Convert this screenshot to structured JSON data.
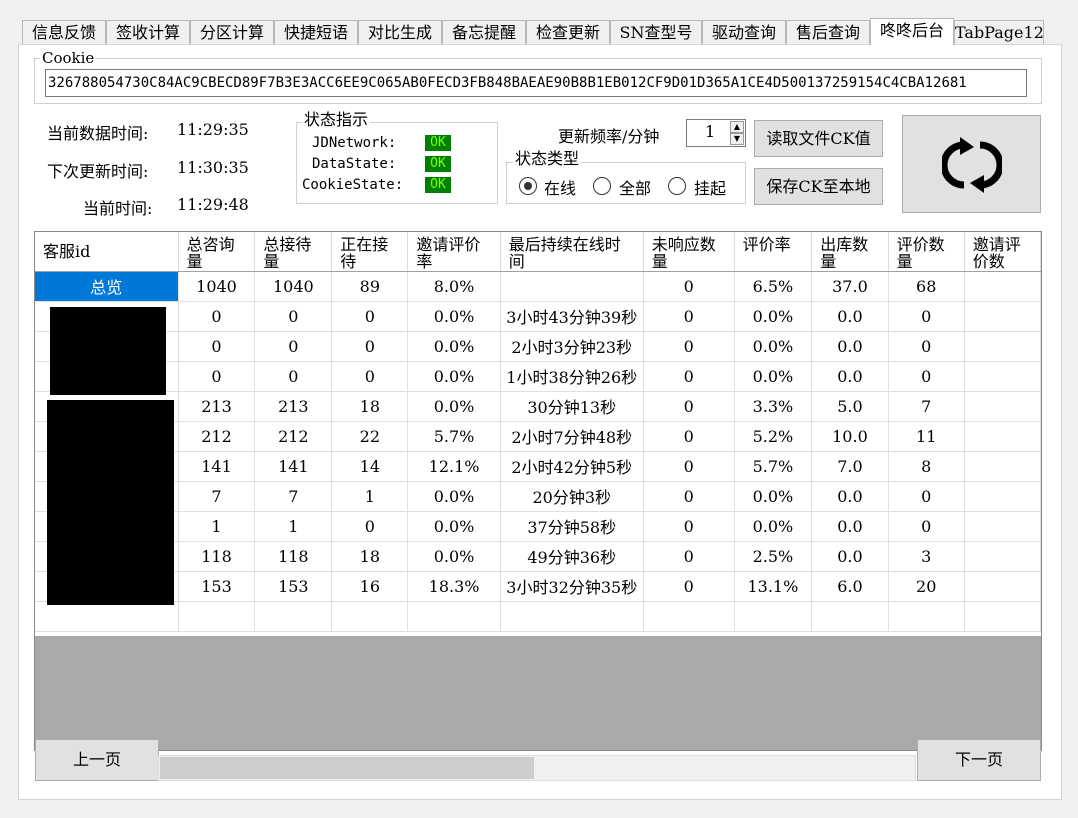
{
  "tabs": [
    "信息反馈",
    "签收计算",
    "分区计算",
    "快捷短语",
    "对比生成",
    "备忘提醒",
    "检查更新",
    "SN查型号",
    "驱动查询",
    "售后查询",
    "咚咚后台",
    "TabPage12"
  ],
  "active_tab": "咚咚后台",
  "cookie": {
    "title": "Cookie",
    "value": "326788054730C84AC9CBECD89F7B3E3ACC6EE9C065AB0FECD3FB848BAEAE90B8B1EB012CF9D01D365A1CE4D500137259154C4CBA12681"
  },
  "times": {
    "current_data_label": "当前数据时间:",
    "current_data_value": "11:29:35",
    "next_update_label": "下次更新时间:",
    "next_update_value": "11:30:35",
    "now_label": "当前时间:",
    "now_value": "11:29:48"
  },
  "status": {
    "title": "状态指示",
    "items": [
      {
        "label": "JDNetwork:",
        "value": "OK"
      },
      {
        "label": "DataState:",
        "value": "OK"
      },
      {
        "label": "CookieState:",
        "value": "OK"
      }
    ],
    "ok_color": "#008000"
  },
  "update": {
    "label": "更新频率/分钟",
    "value": "1"
  },
  "status_type": {
    "title": "状态类型",
    "options": [
      "在线",
      "全部",
      "挂起"
    ],
    "selected": "在线"
  },
  "buttons": {
    "read_ck": "读取文件CK值",
    "save_ck": "保存CK至本地",
    "refresh_icon": "refresh-icon",
    "prev": "上一页",
    "next": "下一页"
  },
  "grid": {
    "columns": [
      "客服id",
      "总咨询量",
      "总接待量",
      "正在接待",
      "邀请评价率",
      "最后持续在线时间",
      "未响应数量",
      "评价率",
      "出库数量",
      "评价数量",
      "邀请评价数"
    ],
    "rows": [
      [
        "总览",
        "1040",
        "1040",
        "89",
        "8.0%",
        "",
        "0",
        "6.5%",
        "37.0",
        "68"
      ],
      [
        "",
        "0",
        "0",
        "0",
        "0.0%",
        "3小时43分钟39秒",
        "0",
        "0.0%",
        "0.0",
        "0"
      ],
      [
        "",
        "0",
        "0",
        "0",
        "0.0%",
        "2小时3分钟23秒",
        "0",
        "0.0%",
        "0.0",
        "0"
      ],
      [
        "",
        "0",
        "0",
        "0",
        "0.0%",
        "1小时38分钟26秒",
        "0",
        "0.0%",
        "0.0",
        "0"
      ],
      [
        "",
        "213",
        "213",
        "18",
        "0.0%",
        "30分钟13秒",
        "0",
        "3.3%",
        "5.0",
        "7"
      ],
      [
        "",
        "212",
        "212",
        "22",
        "5.7%",
        "2小时7分钟48秒",
        "0",
        "5.2%",
        "10.0",
        "11"
      ],
      [
        "",
        "141",
        "141",
        "14",
        "12.1%",
        "2小时42分钟5秒",
        "0",
        "5.7%",
        "7.0",
        "8"
      ],
      [
        "",
        "7",
        "7",
        "1",
        "0.0%",
        "20分钟3秒",
        "0",
        "0.0%",
        "0.0",
        "0"
      ],
      [
        "",
        "1",
        "1",
        "0",
        "0.0%",
        "37分钟58秒",
        "0",
        "0.0%",
        "0.0",
        "0"
      ],
      [
        "",
        "118",
        "118",
        "18",
        "0.0%",
        "49分钟36秒",
        "0",
        "2.5%",
        "0.0",
        "3"
      ],
      [
        "",
        "153",
        "153",
        "16",
        "18.3%",
        "3小时32分钟35秒",
        "0",
        "13.1%",
        "6.0",
        "20"
      ]
    ],
    "selected_color": "#0078d7"
  }
}
